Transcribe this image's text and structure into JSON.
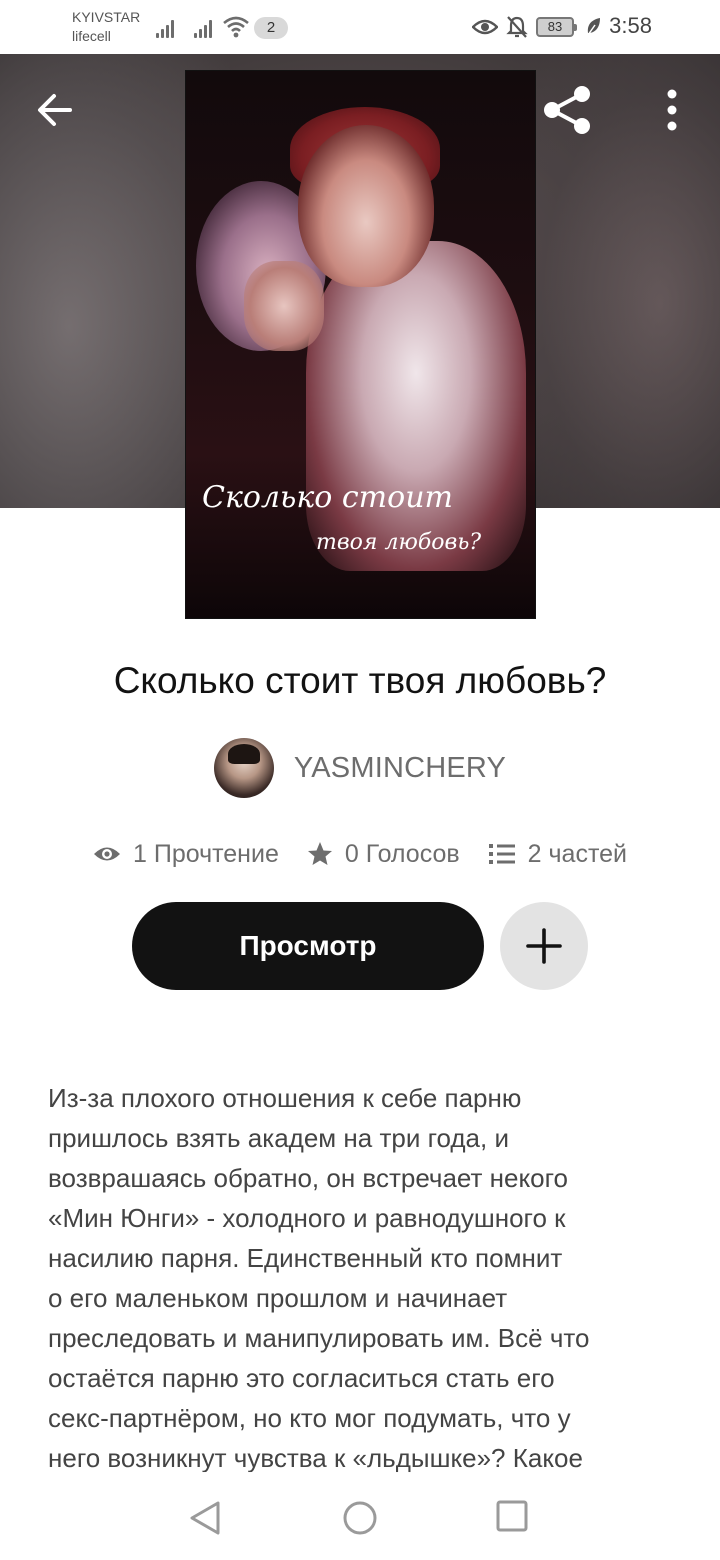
{
  "status_bar": {
    "carrier_1": "KYIVSTAR",
    "carrier_2": "lifecell",
    "sim_badge": "2",
    "battery": "83",
    "time": "3:58",
    "icons": [
      "signal-icon",
      "wifi-icon",
      "eye-icon",
      "mute-icon",
      "battery-icon",
      "leaf-icon"
    ]
  },
  "header": {
    "icons": [
      "back-arrow-icon",
      "share-icon",
      "more-vert-icon"
    ]
  },
  "cover": {
    "script_line_1": "Сколько стоит",
    "script_line_2": "твоя любовь?"
  },
  "story": {
    "title": "Сколько стоит твоя любовь?",
    "author": "YASMINCHERY",
    "stats": {
      "reads": "1 Прочтение",
      "votes": "0 Голосов",
      "parts": "2 частей"
    },
    "read_button": "Просмотр",
    "description": "Из-за плохого отношения к себе парню\nпришлось взять академ на три года, и\nвозврашаясь обратно, он встречает некого\n«Мин Юнги» - холодного и равнодушного к\nнасилию парня. Единственный кто помнит\nо его маленьком прошлом и начинает\nпреследовать и манипулировать им. Всё что\nостаётся парню это согласиться стать его\nсекс-партнёром, но кто мог подумать, что у\nнего возникнут чувства к «льдышке»?  Какое"
  },
  "colors": {
    "primary_button": "#121212",
    "secondary_button": "#e3e3e3",
    "muted_text": "#6d6d6d"
  }
}
